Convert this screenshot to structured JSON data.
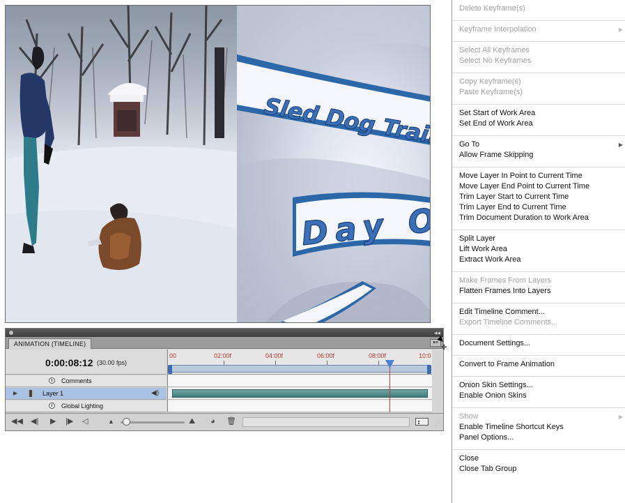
{
  "preview": {
    "overlay_line1": "Sled Dog Trainin",
    "overlay_line2": "Day One"
  },
  "timeline": {
    "tab_label": "ANIMATION (TIMELINE)",
    "time_code": "0:00:08:12",
    "fps": "(30.00 fps)",
    "ruler_ticks": [
      "00",
      "02:00f",
      "04:00f",
      "06:00f",
      "08:00f",
      "10:0"
    ],
    "rows": {
      "comments": "Comments",
      "layer": "Layer 1",
      "global_lighting": "Global Lighting"
    },
    "playhead_fraction": 0.84
  },
  "menu": {
    "groups": [
      [
        {
          "label": "Delete Keyframe(s)",
          "disabled": true
        }
      ],
      [
        {
          "label": "Keyframe Interpolation",
          "disabled": true,
          "submenu": true
        }
      ],
      [
        {
          "label": "Select All Keyframes",
          "disabled": true
        },
        {
          "label": "Select No Keyframes",
          "disabled": true
        }
      ],
      [
        {
          "label": "Copy Keyframe(s)",
          "disabled": true
        },
        {
          "label": "Paste Keyframe(s)",
          "disabled": true
        }
      ],
      [
        {
          "label": "Set Start of Work Area"
        },
        {
          "label": "Set End of Work Area"
        }
      ],
      [
        {
          "label": "Go To",
          "submenu": true
        },
        {
          "label": "Allow Frame Skipping"
        }
      ],
      [
        {
          "label": "Move Layer In Point to Current Time"
        },
        {
          "label": "Move Layer End Point to Current Time"
        },
        {
          "label": "Trim Layer Start to Current Time"
        },
        {
          "label": "Trim Layer End to Current Time"
        },
        {
          "label": "Trim Document Duration to Work Area"
        }
      ],
      [
        {
          "label": "Split Layer"
        },
        {
          "label": "Lift Work Area"
        },
        {
          "label": "Extract Work Area"
        }
      ],
      [
        {
          "label": "Make Frames From Layers",
          "disabled": true
        },
        {
          "label": "Flatten Frames Into Layers"
        }
      ],
      [
        {
          "label": "Edit Timeline Comment..."
        },
        {
          "label": "Export Timeline Comments...",
          "disabled": true
        }
      ],
      [
        {
          "label": "Document Settings..."
        }
      ],
      [
        {
          "label": "Convert to Frame Animation"
        }
      ],
      [
        {
          "label": "Onion Skin Settings..."
        },
        {
          "label": "Enable Onion Skins"
        }
      ],
      [
        {
          "label": "Show",
          "disabled": true,
          "submenu": true
        },
        {
          "label": "Enable Timeline Shortcut Keys"
        },
        {
          "label": "Panel Options..."
        }
      ],
      [
        {
          "label": "Close"
        },
        {
          "label": "Close Tab Group"
        }
      ]
    ]
  },
  "colors": {
    "playhead": "#d03434",
    "layer_bar": "#3f7c79",
    "selected_row": "#aac3e4",
    "disabled_text": "#a3a3a3"
  }
}
